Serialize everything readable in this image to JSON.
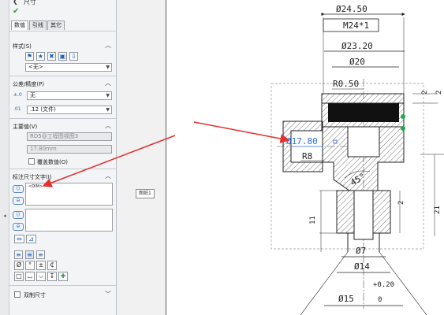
{
  "panel": {
    "title": "尺寸",
    "tabs": [
      {
        "label": "数值"
      },
      {
        "label": "引线"
      },
      {
        "label": "其它"
      }
    ],
    "style": {
      "title": "样式(S)",
      "select_value": "<无>"
    },
    "tolerance": {
      "title": "公差/精度(P)",
      "type_value": "无",
      "precision_value": ".12 (文件)"
    },
    "primary_value": {
      "title": "主要值(V)",
      "field_value": "RD5@工程图视图3",
      "number_value": "17.80mm",
      "override_label": "覆盖数值(O)"
    },
    "dim_text": {
      "title": "标注尺寸文字(I)",
      "content": "<DIM>"
    },
    "dual": {
      "label": "双制尺寸"
    },
    "symbols": [
      "Ø",
      "°",
      "±",
      "₵",
      "□",
      "⌴",
      "⌵",
      "↧",
      "✚"
    ]
  },
  "tooltip": {
    "label": "图纸1"
  },
  "drawing": {
    "dims": {
      "d24_50": "Ø24.50",
      "m24": "M24*1",
      "d23_20": "Ø23.20",
      "d20": "Ø20",
      "r0_50": "R0.50",
      "d17_80": "Ø17.80",
      "r8": "R8",
      "angle45": "45°",
      "d7": "Ø7",
      "d14": "Ø14",
      "d15": "Ø15",
      "tol_upper": "+0.20",
      "tol_lower": "0",
      "n2a": "2",
      "n2b": "2",
      "n2c": "2",
      "n11": "11",
      "n21": "21"
    }
  },
  "colors": {
    "accent_blue": "#2f6fd6",
    "arrow_red": "#e03030",
    "check_green": "#2e9b3a",
    "panel_bg": "#f3f4f6"
  }
}
